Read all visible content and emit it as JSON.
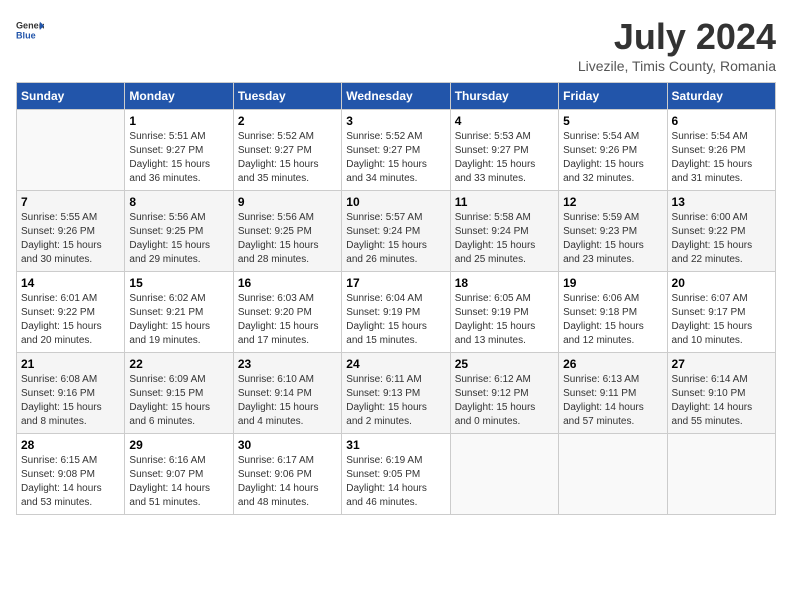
{
  "header": {
    "logo_general": "General",
    "logo_blue": "Blue",
    "title": "July 2024",
    "location": "Livezile, Timis County, Romania"
  },
  "days_of_week": [
    "Sunday",
    "Monday",
    "Tuesday",
    "Wednesday",
    "Thursday",
    "Friday",
    "Saturday"
  ],
  "weeks": [
    [
      {
        "date": "",
        "sunrise": "",
        "sunset": "",
        "daylight": "",
        "empty": true
      },
      {
        "date": "1",
        "sunrise": "Sunrise: 5:51 AM",
        "sunset": "Sunset: 9:27 PM",
        "daylight": "Daylight: 15 hours and 36 minutes.",
        "empty": false
      },
      {
        "date": "2",
        "sunrise": "Sunrise: 5:52 AM",
        "sunset": "Sunset: 9:27 PM",
        "daylight": "Daylight: 15 hours and 35 minutes.",
        "empty": false
      },
      {
        "date": "3",
        "sunrise": "Sunrise: 5:52 AM",
        "sunset": "Sunset: 9:27 PM",
        "daylight": "Daylight: 15 hours and 34 minutes.",
        "empty": false
      },
      {
        "date": "4",
        "sunrise": "Sunrise: 5:53 AM",
        "sunset": "Sunset: 9:27 PM",
        "daylight": "Daylight: 15 hours and 33 minutes.",
        "empty": false
      },
      {
        "date": "5",
        "sunrise": "Sunrise: 5:54 AM",
        "sunset": "Sunset: 9:26 PM",
        "daylight": "Daylight: 15 hours and 32 minutes.",
        "empty": false
      },
      {
        "date": "6",
        "sunrise": "Sunrise: 5:54 AM",
        "sunset": "Sunset: 9:26 PM",
        "daylight": "Daylight: 15 hours and 31 minutes.",
        "empty": false
      }
    ],
    [
      {
        "date": "7",
        "sunrise": "Sunrise: 5:55 AM",
        "sunset": "Sunset: 9:26 PM",
        "daylight": "Daylight: 15 hours and 30 minutes.",
        "empty": false
      },
      {
        "date": "8",
        "sunrise": "Sunrise: 5:56 AM",
        "sunset": "Sunset: 9:25 PM",
        "daylight": "Daylight: 15 hours and 29 minutes.",
        "empty": false
      },
      {
        "date": "9",
        "sunrise": "Sunrise: 5:56 AM",
        "sunset": "Sunset: 9:25 PM",
        "daylight": "Daylight: 15 hours and 28 minutes.",
        "empty": false
      },
      {
        "date": "10",
        "sunrise": "Sunrise: 5:57 AM",
        "sunset": "Sunset: 9:24 PM",
        "daylight": "Daylight: 15 hours and 26 minutes.",
        "empty": false
      },
      {
        "date": "11",
        "sunrise": "Sunrise: 5:58 AM",
        "sunset": "Sunset: 9:24 PM",
        "daylight": "Daylight: 15 hours and 25 minutes.",
        "empty": false
      },
      {
        "date": "12",
        "sunrise": "Sunrise: 5:59 AM",
        "sunset": "Sunset: 9:23 PM",
        "daylight": "Daylight: 15 hours and 23 minutes.",
        "empty": false
      },
      {
        "date": "13",
        "sunrise": "Sunrise: 6:00 AM",
        "sunset": "Sunset: 9:22 PM",
        "daylight": "Daylight: 15 hours and 22 minutes.",
        "empty": false
      }
    ],
    [
      {
        "date": "14",
        "sunrise": "Sunrise: 6:01 AM",
        "sunset": "Sunset: 9:22 PM",
        "daylight": "Daylight: 15 hours and 20 minutes.",
        "empty": false
      },
      {
        "date": "15",
        "sunrise": "Sunrise: 6:02 AM",
        "sunset": "Sunset: 9:21 PM",
        "daylight": "Daylight: 15 hours and 19 minutes.",
        "empty": false
      },
      {
        "date": "16",
        "sunrise": "Sunrise: 6:03 AM",
        "sunset": "Sunset: 9:20 PM",
        "daylight": "Daylight: 15 hours and 17 minutes.",
        "empty": false
      },
      {
        "date": "17",
        "sunrise": "Sunrise: 6:04 AM",
        "sunset": "Sunset: 9:19 PM",
        "daylight": "Daylight: 15 hours and 15 minutes.",
        "empty": false
      },
      {
        "date": "18",
        "sunrise": "Sunrise: 6:05 AM",
        "sunset": "Sunset: 9:19 PM",
        "daylight": "Daylight: 15 hours and 13 minutes.",
        "empty": false
      },
      {
        "date": "19",
        "sunrise": "Sunrise: 6:06 AM",
        "sunset": "Sunset: 9:18 PM",
        "daylight": "Daylight: 15 hours and 12 minutes.",
        "empty": false
      },
      {
        "date": "20",
        "sunrise": "Sunrise: 6:07 AM",
        "sunset": "Sunset: 9:17 PM",
        "daylight": "Daylight: 15 hours and 10 minutes.",
        "empty": false
      }
    ],
    [
      {
        "date": "21",
        "sunrise": "Sunrise: 6:08 AM",
        "sunset": "Sunset: 9:16 PM",
        "daylight": "Daylight: 15 hours and 8 minutes.",
        "empty": false
      },
      {
        "date": "22",
        "sunrise": "Sunrise: 6:09 AM",
        "sunset": "Sunset: 9:15 PM",
        "daylight": "Daylight: 15 hours and 6 minutes.",
        "empty": false
      },
      {
        "date": "23",
        "sunrise": "Sunrise: 6:10 AM",
        "sunset": "Sunset: 9:14 PM",
        "daylight": "Daylight: 15 hours and 4 minutes.",
        "empty": false
      },
      {
        "date": "24",
        "sunrise": "Sunrise: 6:11 AM",
        "sunset": "Sunset: 9:13 PM",
        "daylight": "Daylight: 15 hours and 2 minutes.",
        "empty": false
      },
      {
        "date": "25",
        "sunrise": "Sunrise: 6:12 AM",
        "sunset": "Sunset: 9:12 PM",
        "daylight": "Daylight: 15 hours and 0 minutes.",
        "empty": false
      },
      {
        "date": "26",
        "sunrise": "Sunrise: 6:13 AM",
        "sunset": "Sunset: 9:11 PM",
        "daylight": "Daylight: 14 hours and 57 minutes.",
        "empty": false
      },
      {
        "date": "27",
        "sunrise": "Sunrise: 6:14 AM",
        "sunset": "Sunset: 9:10 PM",
        "daylight": "Daylight: 14 hours and 55 minutes.",
        "empty": false
      }
    ],
    [
      {
        "date": "28",
        "sunrise": "Sunrise: 6:15 AM",
        "sunset": "Sunset: 9:08 PM",
        "daylight": "Daylight: 14 hours and 53 minutes.",
        "empty": false
      },
      {
        "date": "29",
        "sunrise": "Sunrise: 6:16 AM",
        "sunset": "Sunset: 9:07 PM",
        "daylight": "Daylight: 14 hours and 51 minutes.",
        "empty": false
      },
      {
        "date": "30",
        "sunrise": "Sunrise: 6:17 AM",
        "sunset": "Sunset: 9:06 PM",
        "daylight": "Daylight: 14 hours and 48 minutes.",
        "empty": false
      },
      {
        "date": "31",
        "sunrise": "Sunrise: 6:19 AM",
        "sunset": "Sunset: 9:05 PM",
        "daylight": "Daylight: 14 hours and 46 minutes.",
        "empty": false
      },
      {
        "date": "",
        "sunrise": "",
        "sunset": "",
        "daylight": "",
        "empty": true
      },
      {
        "date": "",
        "sunrise": "",
        "sunset": "",
        "daylight": "",
        "empty": true
      },
      {
        "date": "",
        "sunrise": "",
        "sunset": "",
        "daylight": "",
        "empty": true
      }
    ]
  ]
}
